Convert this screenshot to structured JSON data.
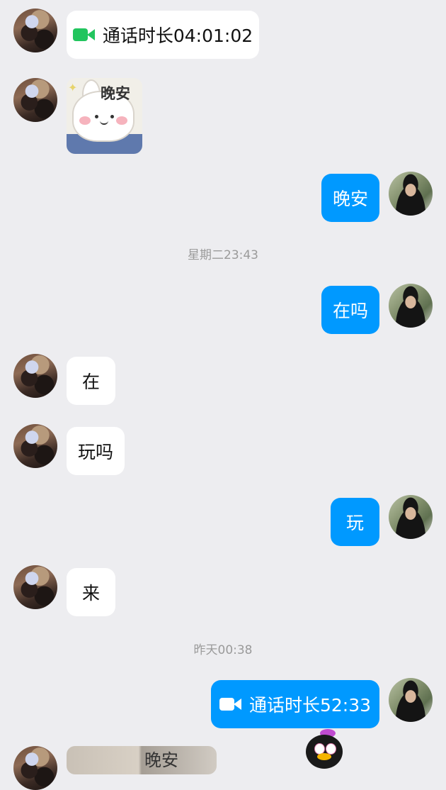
{
  "messages": {
    "m1_call_text": "通话时长04:01:02",
    "m2_sticker_caption": "晚安",
    "m3_text": "晚安",
    "ts1": "星期二23:43",
    "m4_text": "在吗",
    "m5_text": "在",
    "m6_text": "玩吗",
    "m7_text": "玩",
    "m8_text": "来",
    "ts2": "昨天00:38",
    "m9_call_text": "通话时长52:33",
    "peek_text": "晚安"
  },
  "colors": {
    "background": "#ededf0",
    "incoming_bubble": "#ffffff",
    "outgoing_bubble": "#0099ff",
    "video_icon_green": "#22c55e",
    "timestamp_text": "#9a9a9a"
  },
  "icons": {
    "video_call_in": "video-camera-icon",
    "video_call_out": "video-camera-icon",
    "sticker": "good-night-bunny-sticker",
    "emoji": "qq-penguin-sticker"
  }
}
